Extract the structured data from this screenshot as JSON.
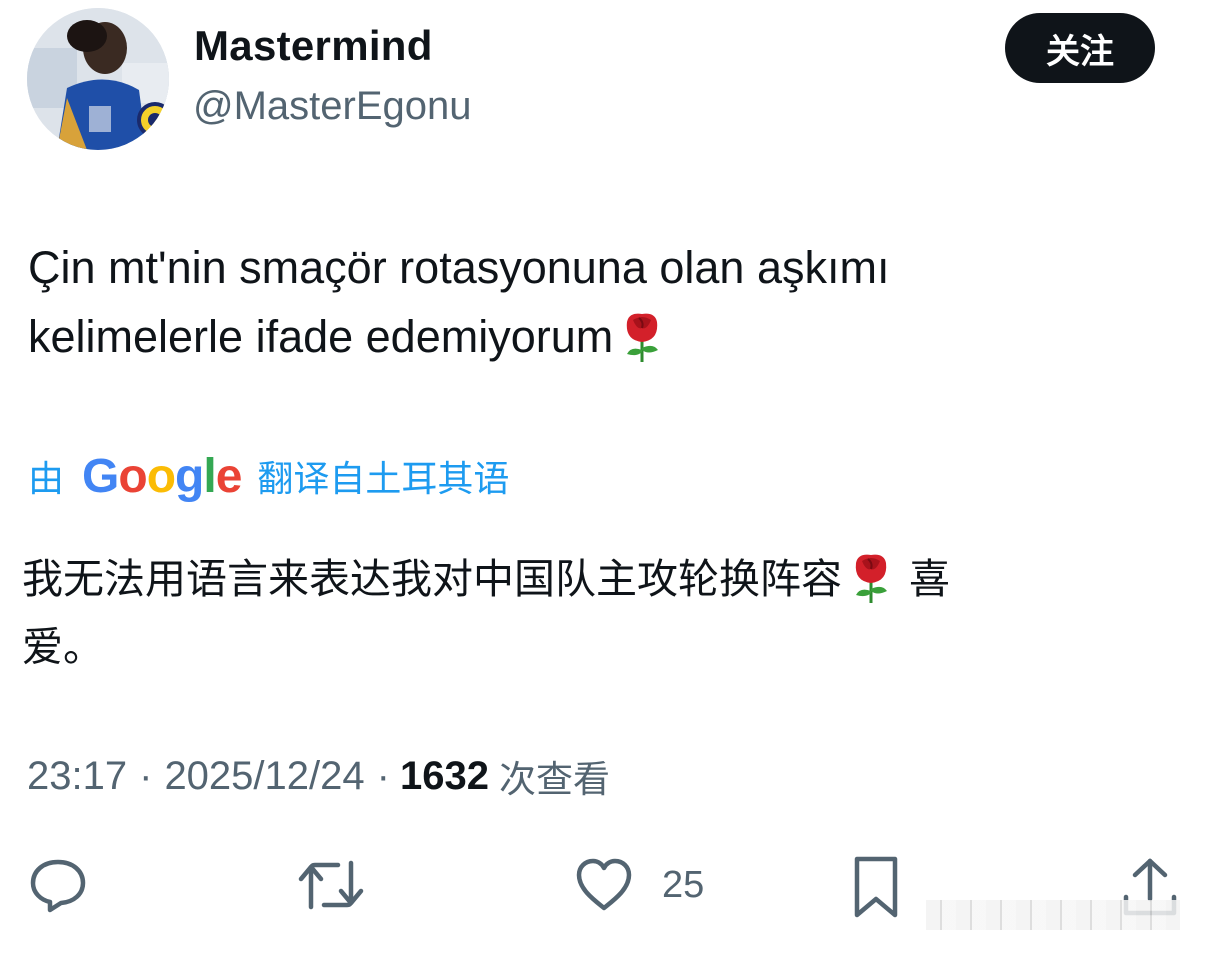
{
  "profile": {
    "display_name": "Mastermind",
    "handle": "@MasterEgonu",
    "follow_label": "关注"
  },
  "tweet": {
    "text": "Çin mt'nin smaçör rotasyonuna olan aşkımı\nkelimelerle ifade edemiyorum",
    "emoji": "rose-emoji"
  },
  "translation": {
    "prefix": "由",
    "provider": "Google",
    "suffix": "翻译自土耳其语",
    "text_before": "我无法用语言来表达我对中国队主攻轮换阵容",
    "text_after": " 喜\n爱。"
  },
  "meta": {
    "time": "23:17",
    "separator": "·",
    "date": "2025/12/24",
    "views": "1632",
    "views_label": "次查看"
  },
  "actions": {
    "like_count": "25",
    "icons": [
      "reply-icon",
      "retweet-icon",
      "like-icon",
      "bookmark-icon",
      "share-icon"
    ]
  },
  "colors": {
    "accent": "#1d9bf0",
    "muted": "#536471",
    "text": "#0f1419",
    "follow_bg": "#0f1419"
  }
}
